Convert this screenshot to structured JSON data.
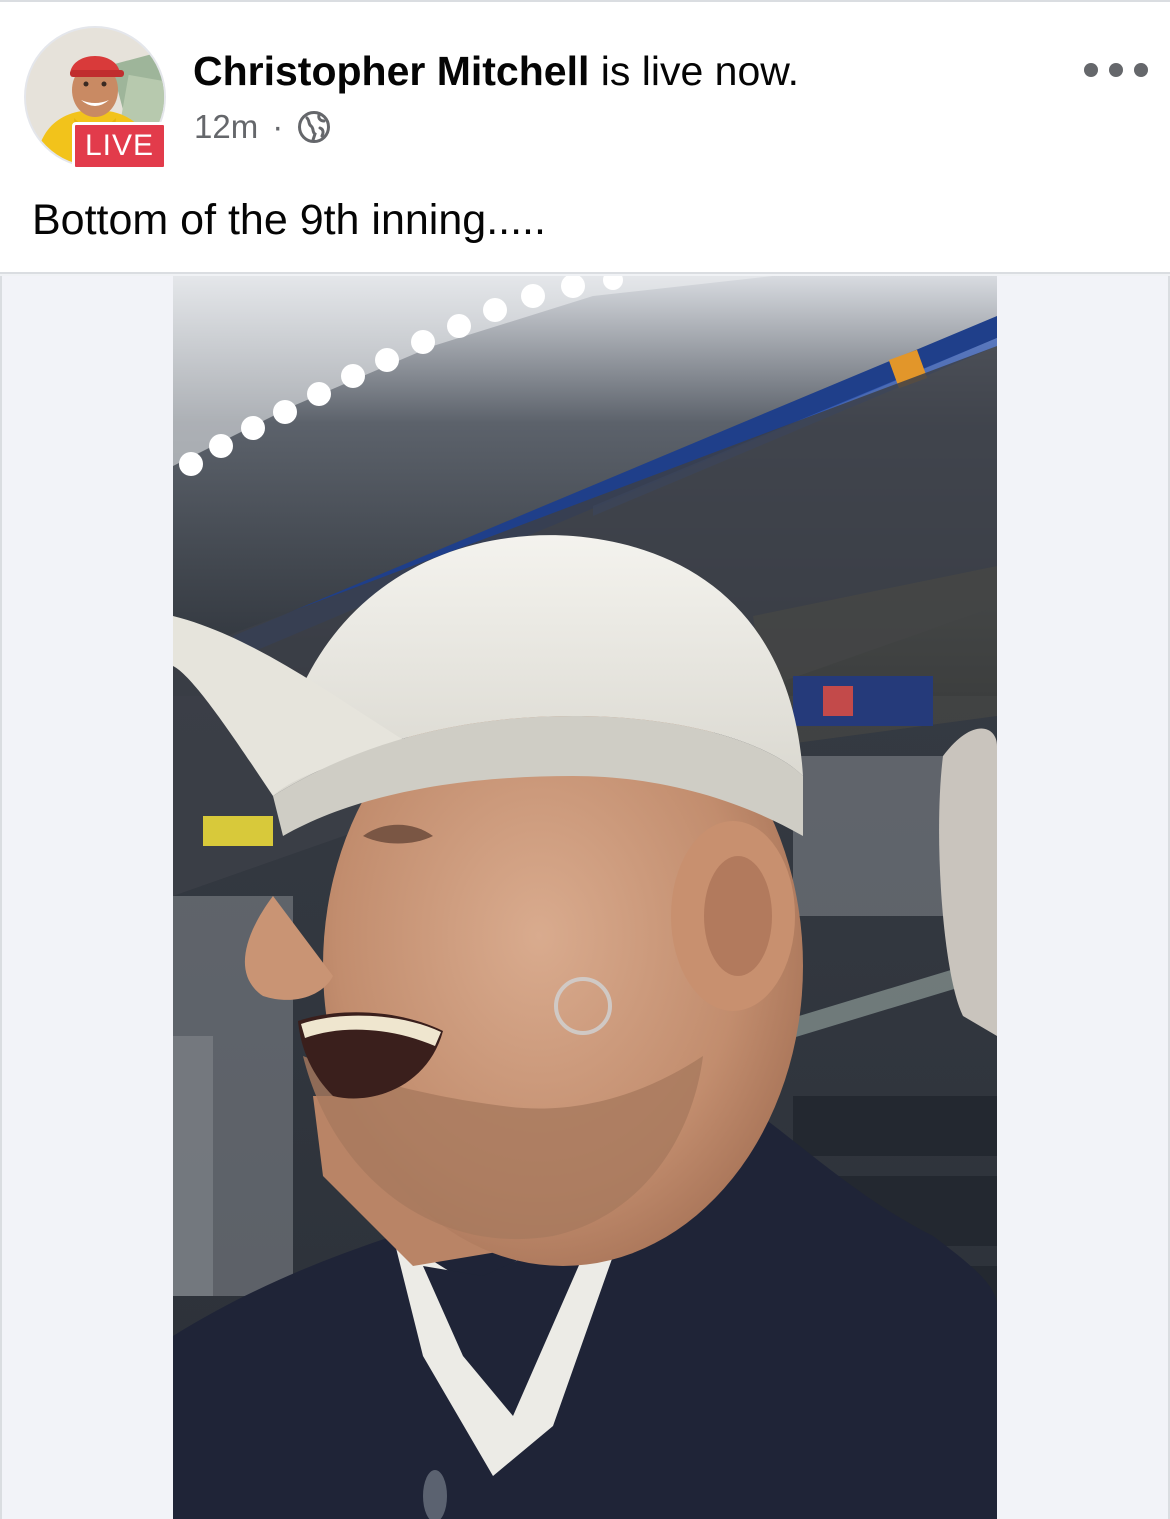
{
  "post": {
    "author_name": "Christopher Mitchell",
    "status_text": " is live now.",
    "live_badge": "LIVE",
    "timestamp": "12m",
    "separator": "·",
    "privacy_icon": "globe-icon",
    "more_icon": "more-options-icon",
    "caption": "Bottom of the 9th inning....."
  },
  "colors": {
    "live_red": "#e23b4b",
    "text_primary": "#050505",
    "text_secondary": "#65676b"
  }
}
